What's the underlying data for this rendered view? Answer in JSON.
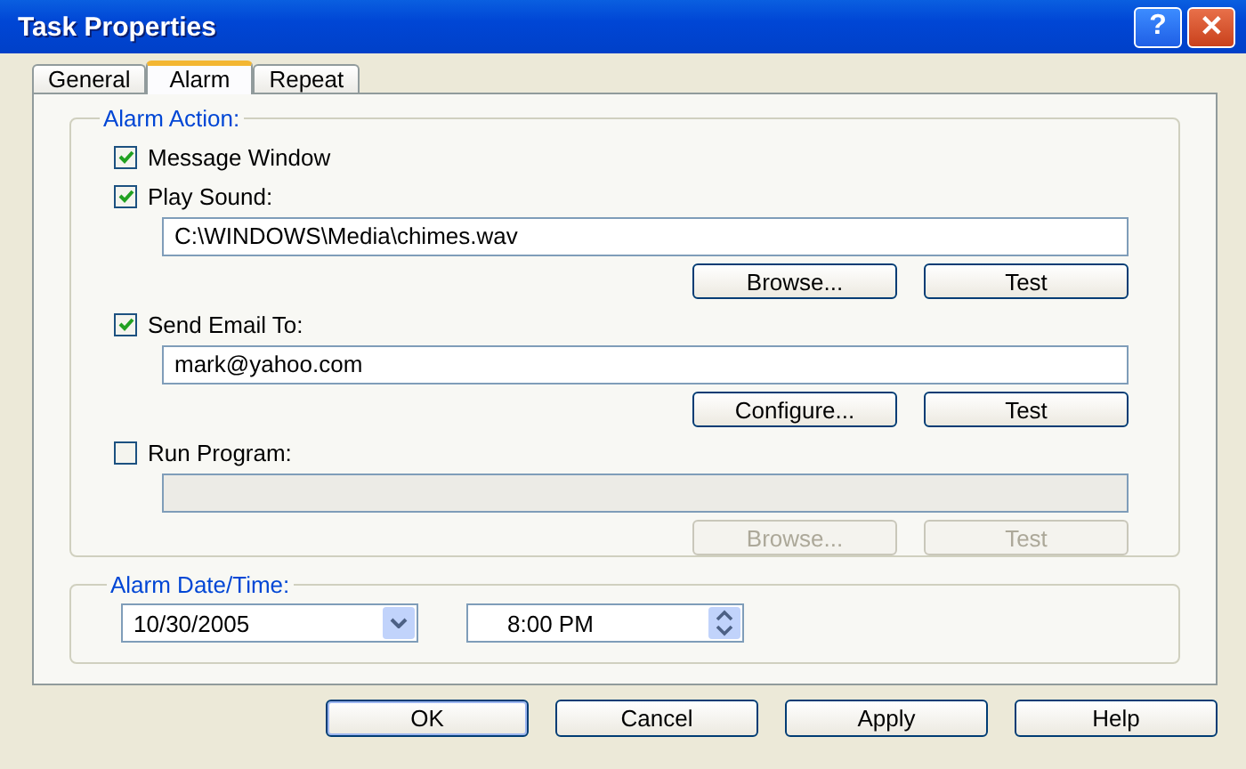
{
  "window": {
    "title": "Task Properties",
    "help_button": "?",
    "close_button": "✕"
  },
  "tabs": [
    {
      "label": "General",
      "selected": false
    },
    {
      "label": "Alarm",
      "selected": true
    },
    {
      "label": "Repeat",
      "selected": false
    }
  ],
  "alarm_action": {
    "title": "Alarm Action:",
    "items": [
      {
        "label": "Message Window",
        "checked": true
      },
      {
        "label": "Play Sound:",
        "checked": true,
        "field": {
          "value": "C:\\WINDOWS\\Media\\chimes.wav",
          "disabled": false
        },
        "buttons": [
          {
            "label": "Browse...",
            "disabled": false
          },
          {
            "label": "Test",
            "disabled": false
          }
        ]
      },
      {
        "label": "Send Email To:",
        "checked": true,
        "field": {
          "value": "mark@yahoo.com",
          "disabled": false
        },
        "buttons": [
          {
            "label": "Configure...",
            "disabled": false
          },
          {
            "label": "Test",
            "disabled": false
          }
        ]
      },
      {
        "label": "Run Program:",
        "checked": false,
        "field": {
          "disabled": true
        },
        "buttons": [
          {
            "label": "Browse...",
            "disabled": true
          },
          {
            "label": "Test",
            "disabled": true
          }
        ]
      }
    ]
  },
  "alarm_datetime": {
    "title": "Alarm Date/Time:",
    "date": "10/30/2005",
    "time": "8:00 PM"
  },
  "buttons": [
    {
      "label": "OK",
      "default": true
    },
    {
      "label": "Cancel",
      "default": false
    },
    {
      "label": "Apply",
      "default": false
    },
    {
      "label": "Help",
      "default": false
    }
  ]
}
